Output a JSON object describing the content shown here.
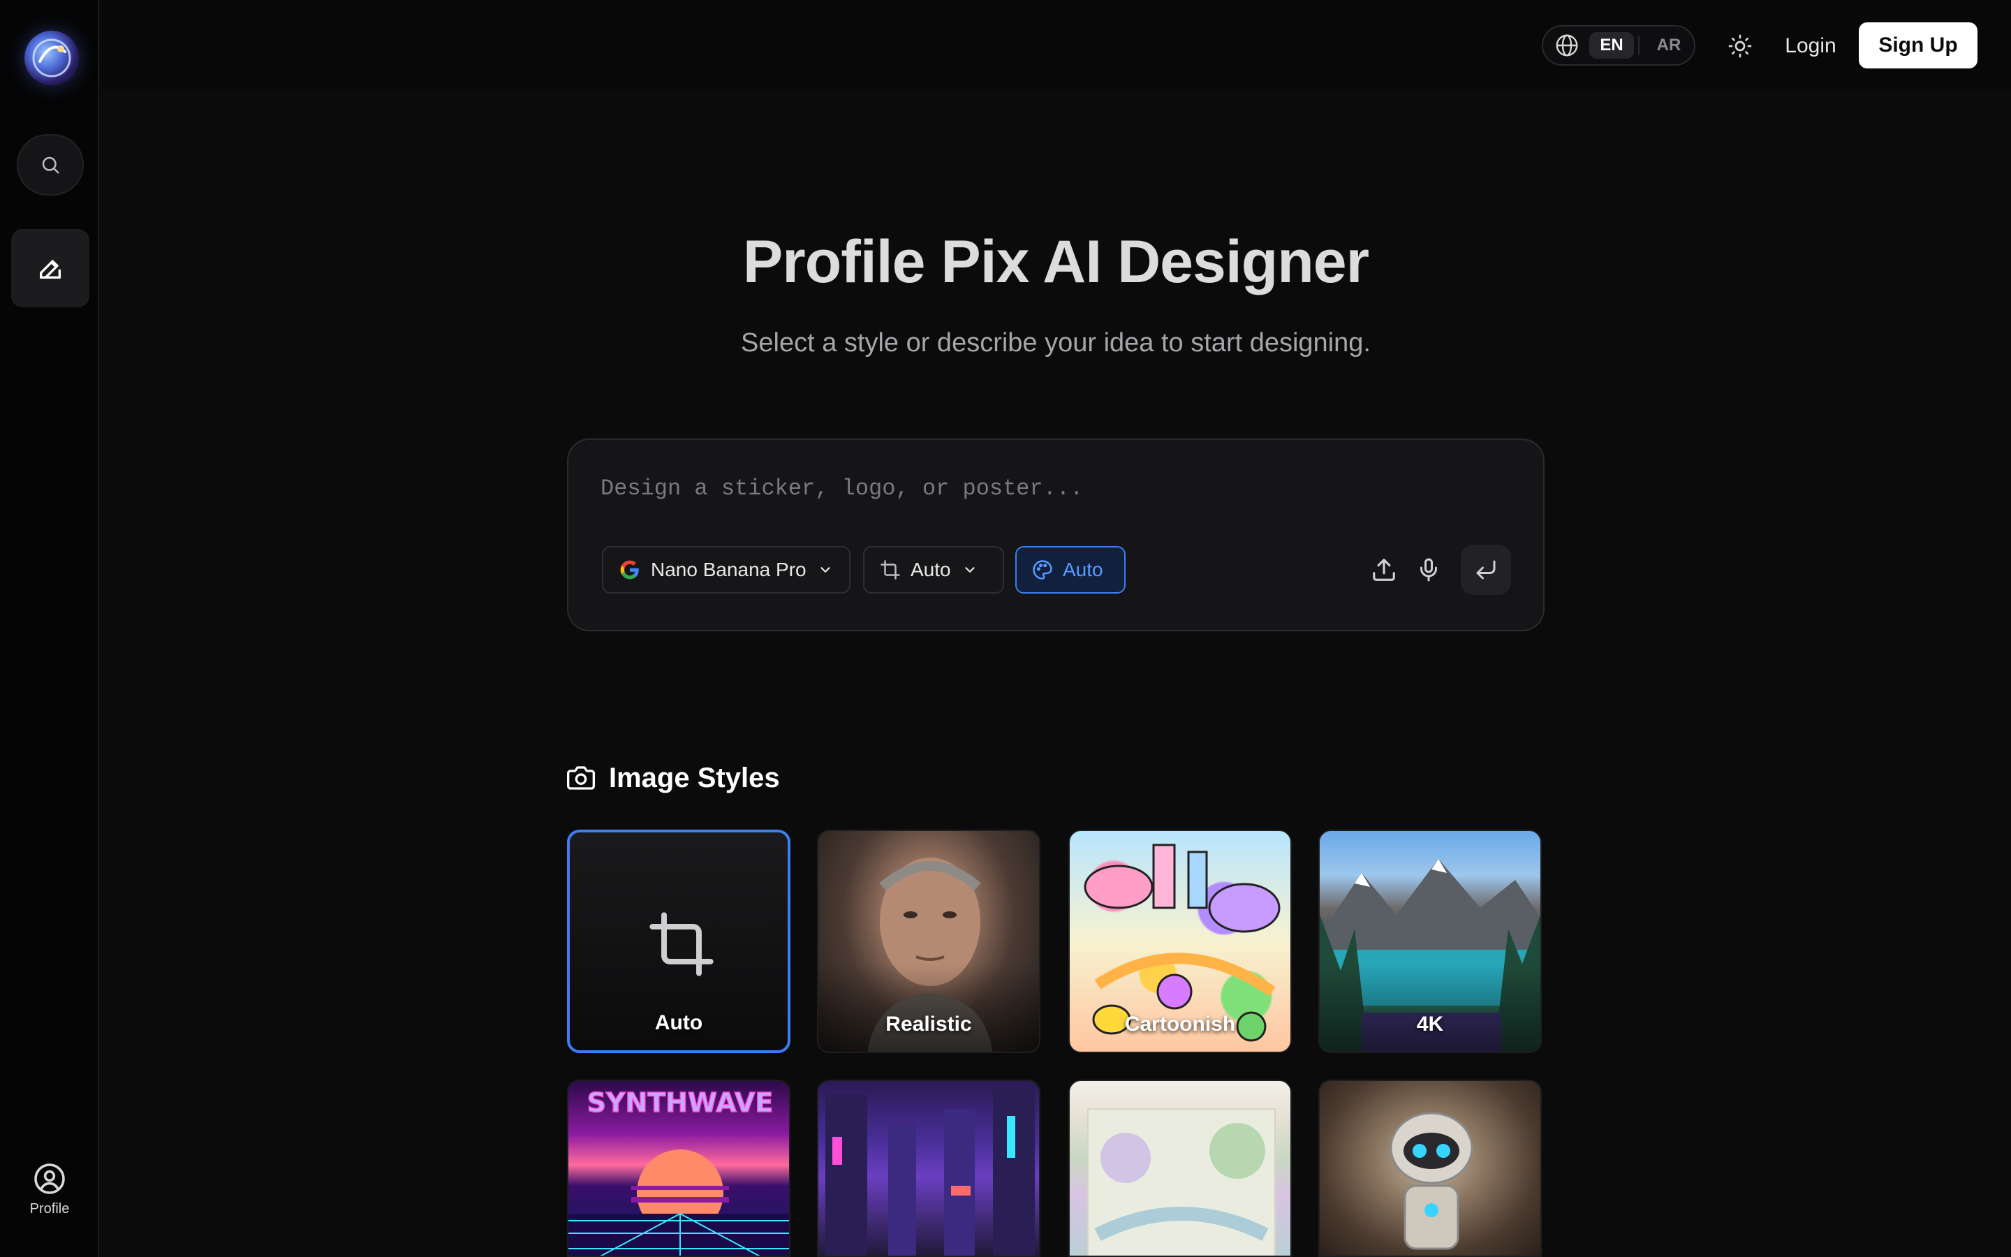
{
  "topbar": {
    "lang_options": [
      "EN",
      "AR"
    ],
    "login_label": "Login",
    "signup_label": "Sign Up"
  },
  "sidebar": {
    "profile_label": "Profile"
  },
  "hero": {
    "title": "Profile Pix AI Designer",
    "subtitle": "Select a style or describe your idea to start designing."
  },
  "prompt": {
    "placeholder": "Design a sticker, logo, or poster...",
    "value": "",
    "model_label": "Nano Banana Pro",
    "ratio_label": "Auto",
    "style_label": "Auto"
  },
  "styles_section": {
    "title": "Image Styles",
    "cards": [
      {
        "label": "Auto",
        "selected": true
      },
      {
        "label": "Realistic"
      },
      {
        "label": "Cartoonish"
      },
      {
        "label": "4K"
      },
      {
        "label": "SYNTHWAVE"
      },
      {
        "label": ""
      },
      {
        "label": ""
      },
      {
        "label": ""
      }
    ]
  },
  "colors": {
    "accent": "#3b7ff0",
    "background": "#0b0b0c",
    "surface": "#151517"
  }
}
